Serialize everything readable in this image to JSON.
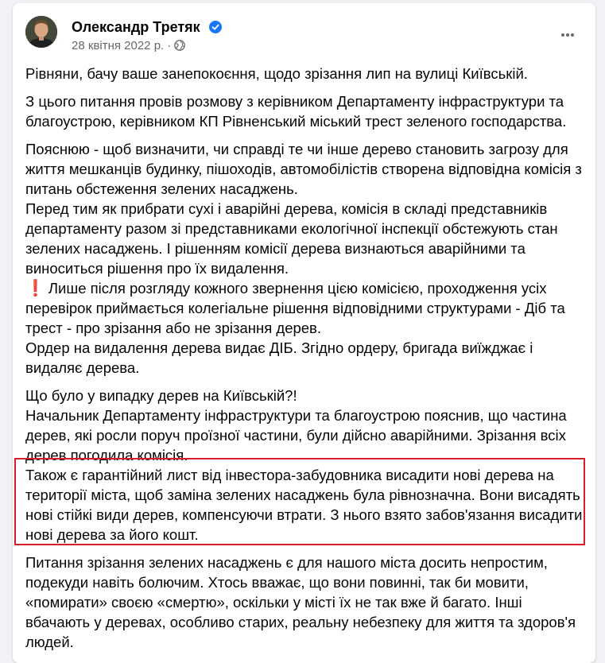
{
  "post": {
    "author": "Олександр Третяк",
    "date": "28 квітня 2022 р.",
    "separator": "·",
    "paragraphs": {
      "p1": "Рівняни, бачу ваше занепокоєння, щодо зрізання лип на вулиці Київській.",
      "p2": "З цього питання провів розмову з керівником Департаменту інфраструктури та благоустрою, керівником КП Рівненський міський трест зеленого господарства.",
      "p3": "Пояснюю - щоб визначити, чи справді те чи інше дерево становить загрозу для життя мешканців будинку, пішоходів, автомобілістів створена відповідна комісія з питань обстеження зелених насаджень.",
      "p4": "Перед тим як прибрати сухі і аварійні дерева, комісія в складі представників департаменту разом зі представниками  екологічної  інспекції обстежують стан зелених насаджень. І рішенням комісії дерева визнаються аварійними та виноситься рішення про їх видалення.",
      "p5": "Лише після розгляду кожного звернення цією комісією, проходження усіх перевірок приймається колегіальне рішення відповідними структурами - Діб та трест - про зрізання або не зрізання дерев.",
      "p6": "Ордер на видалення дерева видає ДІБ. Згідно ордеру, бригада виїжджає і видаляє дерева.",
      "p7": "Що було у випадку дерев на Київській?!",
      "p8": "Начальник Департаменту інфраструктури та благоустрою пояснив, що частина дерев, які росли поруч проїзної частини, були дійсно аварійними. Зрізання всіх дерев погодила комісія.",
      "p9": "Також є гарантійний лист від інвестора-забудовника висадити нові дерева на території міста, щоб заміна зелених насаджень була рівнозначна. Вони висадять нові стійкі види дерев, компенсуючи втрати. З нього взято забов'язання висадити нові дерева за його кошт.",
      "p10": " Питання зрізання зелених насаджень є для нашого міста досить непростим, подекуди навіть болючим. Хтось вважає, що вони повинні, так би мовити, «помирати» своєю «смертю», оскільки у місті їх не так вже й багато. Інші вбачають у деревах, особливо старих, реальну небезпеку для життя та здоров'я людей."
    }
  },
  "icons": {
    "verified": "verified-badge-icon",
    "audience": "globe-icon",
    "more": "more-options-icon",
    "exclamation": "red-exclamation-icon"
  },
  "colors": {
    "verified_blue": "#1877f2",
    "highlight_red": "#d41f2a",
    "meta_gray": "#65676b",
    "exclamation_red": "#dd2e44"
  }
}
